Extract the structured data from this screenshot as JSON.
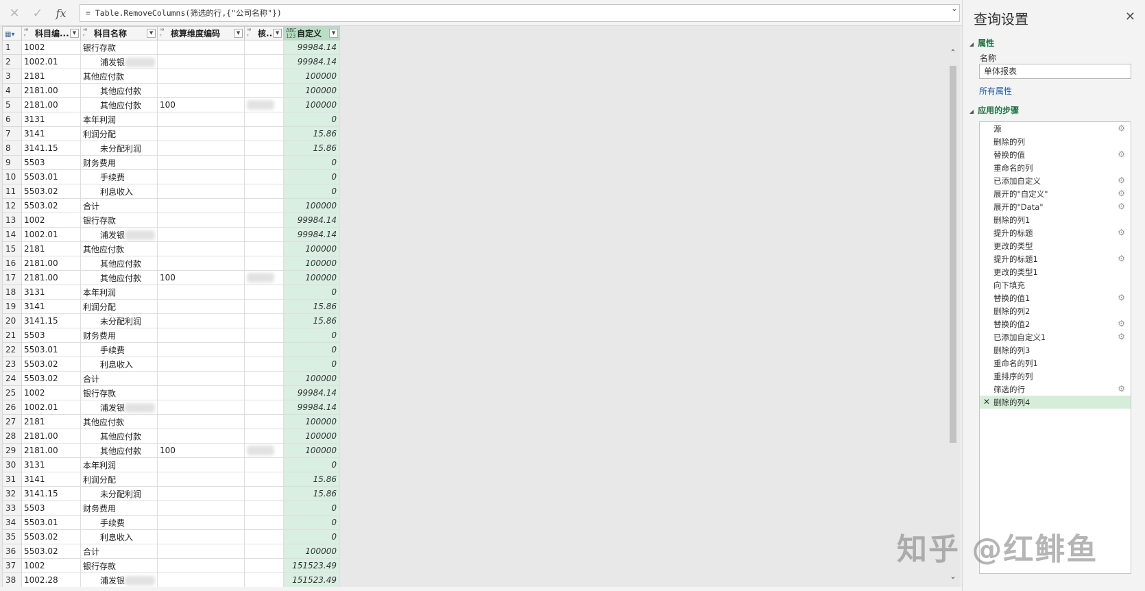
{
  "formula_bar": {
    "cancel_icon": "x-icon",
    "commit_icon": "check-icon",
    "fx_label": "fx",
    "formula": "= Table.RemoveColumns(筛选的行,{\"公司名称\"})"
  },
  "columns": [
    {
      "type": "ABC",
      "label": "科目编..."
    },
    {
      "type": "ABC",
      "label": "科目名称"
    },
    {
      "type": "ABC",
      "label": "核算维度编码"
    },
    {
      "type": "ABC",
      "label": "核..."
    },
    {
      "type": "ABC123",
      "label": "自定义"
    }
  ],
  "rows": [
    {
      "n": "1",
      "code": "1002",
      "name": "银行存款",
      "dim": "",
      "blur_name": false,
      "blur_dim": false,
      "val": "99984.14",
      "indent": false
    },
    {
      "n": "2",
      "code": "1002.01",
      "name": "浦发银",
      "dim": "",
      "blur_name": true,
      "blur_dim": false,
      "val": "99984.14",
      "indent": true
    },
    {
      "n": "3",
      "code": "2181",
      "name": "其他应付款",
      "dim": "",
      "blur_name": false,
      "blur_dim": false,
      "val": "100000",
      "indent": false
    },
    {
      "n": "4",
      "code": "2181.00",
      "name": "其他应付款",
      "dim": "",
      "blur_name": false,
      "blur_dim": false,
      "val": "100000",
      "indent": true
    },
    {
      "n": "5",
      "code": "2181.00",
      "name": "其他应付款",
      "dim": "100",
      "blur_name": false,
      "blur_dim": true,
      "val": "100000",
      "indent": true
    },
    {
      "n": "6",
      "code": "3131",
      "name": "本年利润",
      "dim": "",
      "blur_name": false,
      "blur_dim": false,
      "val": "0",
      "indent": false
    },
    {
      "n": "7",
      "code": "3141",
      "name": "利润分配",
      "dim": "",
      "blur_name": false,
      "blur_dim": false,
      "val": "15.86",
      "indent": false
    },
    {
      "n": "8",
      "code": "3141.15",
      "name": "未分配利润",
      "dim": "",
      "blur_name": false,
      "blur_dim": false,
      "val": "15.86",
      "indent": true
    },
    {
      "n": "9",
      "code": "5503",
      "name": "财务费用",
      "dim": "",
      "blur_name": false,
      "blur_dim": false,
      "val": "0",
      "indent": false
    },
    {
      "n": "10",
      "code": "5503.01",
      "name": "手续费",
      "dim": "",
      "blur_name": false,
      "blur_dim": false,
      "val": "0",
      "indent": true
    },
    {
      "n": "11",
      "code": "5503.02",
      "name": "利息收入",
      "dim": "",
      "blur_name": false,
      "blur_dim": false,
      "val": "0",
      "indent": true
    },
    {
      "n": "12",
      "code": "5503.02",
      "name": "合计",
      "dim": "",
      "blur_name": false,
      "blur_dim": false,
      "val": "100000",
      "indent": false
    },
    {
      "n": "13",
      "code": "1002",
      "name": "银行存款",
      "dim": "",
      "blur_name": false,
      "blur_dim": false,
      "val": "99984.14",
      "indent": false
    },
    {
      "n": "14",
      "code": "1002.01",
      "name": "浦发银",
      "dim": "",
      "blur_name": true,
      "blur_dim": false,
      "val": "99984.14",
      "indent": true
    },
    {
      "n": "15",
      "code": "2181",
      "name": "其他应付款",
      "dim": "",
      "blur_name": false,
      "blur_dim": false,
      "val": "100000",
      "indent": false
    },
    {
      "n": "16",
      "code": "2181.00",
      "name": "其他应付款",
      "dim": "",
      "blur_name": false,
      "blur_dim": false,
      "val": "100000",
      "indent": true
    },
    {
      "n": "17",
      "code": "2181.00",
      "name": "其他应付款",
      "dim": "100",
      "blur_name": false,
      "blur_dim": true,
      "val": "100000",
      "indent": true
    },
    {
      "n": "18",
      "code": "3131",
      "name": "本年利润",
      "dim": "",
      "blur_name": false,
      "blur_dim": false,
      "val": "0",
      "indent": false
    },
    {
      "n": "19",
      "code": "3141",
      "name": "利润分配",
      "dim": "",
      "blur_name": false,
      "blur_dim": false,
      "val": "15.86",
      "indent": false
    },
    {
      "n": "20",
      "code": "3141.15",
      "name": "未分配利润",
      "dim": "",
      "blur_name": false,
      "blur_dim": false,
      "val": "15.86",
      "indent": true
    },
    {
      "n": "21",
      "code": "5503",
      "name": "财务费用",
      "dim": "",
      "blur_name": false,
      "blur_dim": false,
      "val": "0",
      "indent": false
    },
    {
      "n": "22",
      "code": "5503.01",
      "name": "手续费",
      "dim": "",
      "blur_name": false,
      "blur_dim": false,
      "val": "0",
      "indent": true
    },
    {
      "n": "23",
      "code": "5503.02",
      "name": "利息收入",
      "dim": "",
      "blur_name": false,
      "blur_dim": false,
      "val": "0",
      "indent": true
    },
    {
      "n": "24",
      "code": "5503.02",
      "name": "合计",
      "dim": "",
      "blur_name": false,
      "blur_dim": false,
      "val": "100000",
      "indent": false
    },
    {
      "n": "25",
      "code": "1002",
      "name": "银行存款",
      "dim": "",
      "blur_name": false,
      "blur_dim": false,
      "val": "99984.14",
      "indent": false
    },
    {
      "n": "26",
      "code": "1002.01",
      "name": "浦发银",
      "dim": "",
      "blur_name": true,
      "blur_dim": false,
      "val": "99984.14",
      "indent": true
    },
    {
      "n": "27",
      "code": "2181",
      "name": "其他应付款",
      "dim": "",
      "blur_name": false,
      "blur_dim": false,
      "val": "100000",
      "indent": false
    },
    {
      "n": "28",
      "code": "2181.00",
      "name": "其他应付款",
      "dim": "",
      "blur_name": false,
      "blur_dim": false,
      "val": "100000",
      "indent": true
    },
    {
      "n": "29",
      "code": "2181.00",
      "name": "其他应付款",
      "dim": "100",
      "blur_name": false,
      "blur_dim": true,
      "val": "100000",
      "indent": true
    },
    {
      "n": "30",
      "code": "3131",
      "name": "本年利润",
      "dim": "",
      "blur_name": false,
      "blur_dim": false,
      "val": "0",
      "indent": false
    },
    {
      "n": "31",
      "code": "3141",
      "name": "利润分配",
      "dim": "",
      "blur_name": false,
      "blur_dim": false,
      "val": "15.86",
      "indent": false
    },
    {
      "n": "32",
      "code": "3141.15",
      "name": "未分配利润",
      "dim": "",
      "blur_name": false,
      "blur_dim": false,
      "val": "15.86",
      "indent": true
    },
    {
      "n": "33",
      "code": "5503",
      "name": "财务费用",
      "dim": "",
      "blur_name": false,
      "blur_dim": false,
      "val": "0",
      "indent": false
    },
    {
      "n": "34",
      "code": "5503.01",
      "name": "手续费",
      "dim": "",
      "blur_name": false,
      "blur_dim": false,
      "val": "0",
      "indent": true
    },
    {
      "n": "35",
      "code": "5503.02",
      "name": "利息收入",
      "dim": "",
      "blur_name": false,
      "blur_dim": false,
      "val": "0",
      "indent": true
    },
    {
      "n": "36",
      "code": "5503.02",
      "name": "合计",
      "dim": "",
      "blur_name": false,
      "blur_dim": false,
      "val": "100000",
      "indent": false
    },
    {
      "n": "37",
      "code": "1002",
      "name": "银行存款",
      "dim": "",
      "blur_name": false,
      "blur_dim": false,
      "val": "151523.49",
      "indent": false
    },
    {
      "n": "38",
      "code": "1002.28",
      "name": "浦发银",
      "dim": "",
      "blur_name": true,
      "blur_dim": false,
      "val": "151523.49",
      "indent": true
    }
  ],
  "pane": {
    "title": "查询设置",
    "close_icon": "close-icon",
    "properties_header": "属性",
    "name_label": "名称",
    "name_value": "单体报表",
    "all_properties_link": "所有属性",
    "steps_header": "应用的步骤",
    "steps": [
      {
        "label": "源",
        "gear": true
      },
      {
        "label": "删除的列",
        "gear": false
      },
      {
        "label": "替换的值",
        "gear": true
      },
      {
        "label": "重命名的列",
        "gear": false
      },
      {
        "label": "已添加自定义",
        "gear": true
      },
      {
        "label": "展开的\"自定义\"",
        "gear": true
      },
      {
        "label": "展开的\"Data\"",
        "gear": true
      },
      {
        "label": "删除的列1",
        "gear": false
      },
      {
        "label": "提升的标题",
        "gear": true
      },
      {
        "label": "更改的类型",
        "gear": false
      },
      {
        "label": "提升的标题1",
        "gear": true
      },
      {
        "label": "更改的类型1",
        "gear": false
      },
      {
        "label": "向下填充",
        "gear": false
      },
      {
        "label": "替换的值1",
        "gear": true
      },
      {
        "label": "删除的列2",
        "gear": false
      },
      {
        "label": "替换的值2",
        "gear": true
      },
      {
        "label": "已添加自定义1",
        "gear": true
      },
      {
        "label": "删除的列3",
        "gear": false
      },
      {
        "label": "重命名的列1",
        "gear": false
      },
      {
        "label": "重排序的列",
        "gear": false
      },
      {
        "label": "筛选的行",
        "gear": true
      },
      {
        "label": "删除的列4",
        "gear": false,
        "active": true
      }
    ]
  },
  "watermark": "知乎 @红鲱鱼",
  "colors": {
    "selected_column": "#d9efe1",
    "accent": "#217346",
    "link": "#1f5aa6"
  }
}
